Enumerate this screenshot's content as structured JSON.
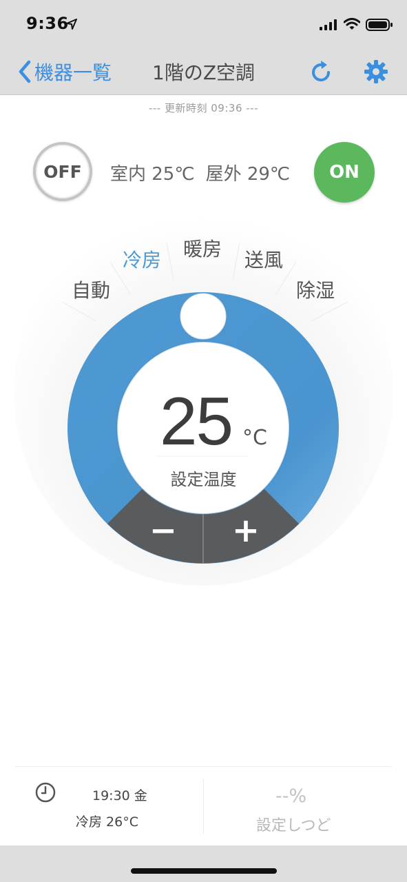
{
  "status_bar": {
    "time": "9:36"
  },
  "nav": {
    "back_label": "機器一覧",
    "title": "1階のZ空調"
  },
  "update": {
    "text": "--- 更新時刻 09:36 ---"
  },
  "power": {
    "off_label": "OFF",
    "on_label": "ON"
  },
  "temps": {
    "indoor": "室内 25℃",
    "outdoor": "屋外 29℃"
  },
  "modes": [
    {
      "label": "自動",
      "active": false
    },
    {
      "label": "冷房",
      "active": true
    },
    {
      "label": "暖房",
      "active": false
    },
    {
      "label": "送風",
      "active": false
    },
    {
      "label": "除湿",
      "active": false
    }
  ],
  "dial": {
    "value": "25",
    "unit": "°C",
    "label": "設定温度",
    "minus": "−",
    "plus": "+"
  },
  "timer": {
    "line1": "19:30 金",
    "line2": "冷房 26°C"
  },
  "humidity": {
    "value": "--%",
    "label": "設定しつど"
  },
  "colors": {
    "accent": "#3a8fe0",
    "dial_blue": "#4d98d2",
    "on_green": "#5cb85c",
    "button_dark": "#5a5b5d"
  },
  "icons": {
    "location": "location-arrow-icon",
    "signal": "signal-icon",
    "wifi": "wifi-icon",
    "battery": "battery-icon",
    "back": "chevron-left-icon",
    "refresh": "refresh-icon",
    "settings": "gear-icon",
    "timer": "clock-icon"
  }
}
